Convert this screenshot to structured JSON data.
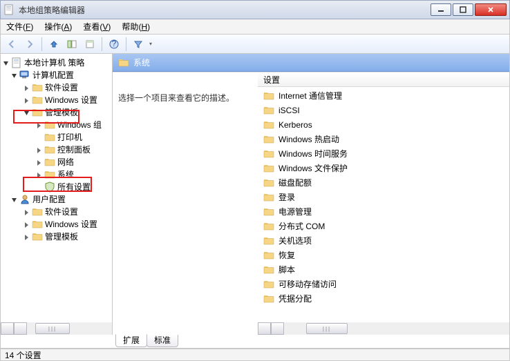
{
  "window": {
    "title": "本地组策略编辑器"
  },
  "menu": {
    "file": "文件",
    "file_hk": "F",
    "action": "操作",
    "action_hk": "A",
    "view": "查看",
    "view_hk": "V",
    "help": "帮助",
    "help_hk": "H"
  },
  "tree": {
    "root": "本地计算机 策略",
    "computer": "计算机配置",
    "c_soft": "软件设置",
    "c_win": "Windows 设置",
    "c_tmpl": "管理模板",
    "c_tmpl_win": "Windows 组",
    "c_tmpl_print": "打印机",
    "c_tmpl_ctrl": "控制面板",
    "c_tmpl_net": "网络",
    "c_tmpl_sys": "系统",
    "c_tmpl_all": "所有设置",
    "user": "用户配置",
    "u_soft": "软件设置",
    "u_win": "Windows 设置",
    "u_tmpl": "管理模板"
  },
  "right": {
    "title": "系统",
    "description_prompt": "选择一个项目来查看它的描述。",
    "col_header": "设置",
    "items": [
      "Internet 通信管理",
      "iSCSI",
      "Kerberos",
      "Windows 热启动",
      "Windows 时间服务",
      "Windows 文件保护",
      "磁盘配额",
      "登录",
      "电源管理",
      "分布式 COM",
      "关机选项",
      "恢复",
      "脚本",
      "可移动存储访问",
      "凭据分配"
    ]
  },
  "tabs": {
    "extended": "扩展",
    "standard": "标准"
  },
  "status": {
    "text": "14 个设置"
  }
}
